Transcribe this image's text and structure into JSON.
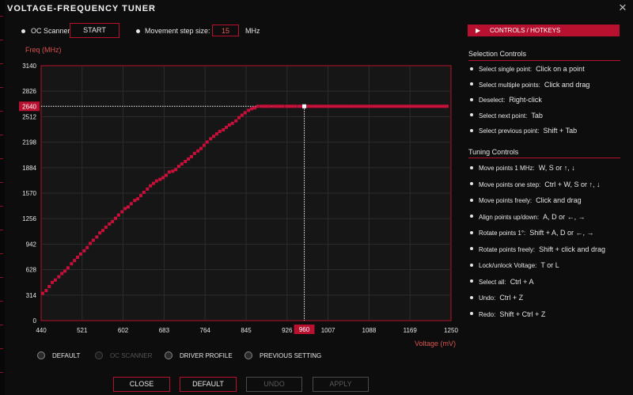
{
  "window": {
    "title": "VOLTAGE-FREQUENCY TUNER"
  },
  "toolbar": {
    "oc_scanner_label": "OC Scanner",
    "start_label": "START",
    "step_label": "Movement step size:",
    "step_value": "15",
    "step_unit": "MHz"
  },
  "chart_data": {
    "type": "scatter",
    "ylabel": "Freq (MHz)",
    "xlabel": "Voltage (mV)",
    "xlim": [
      440,
      1250
    ],
    "ylim": [
      0,
      3140
    ],
    "x_ticks": [
      "440",
      "521",
      "602",
      "683",
      "764",
      "845",
      "926",
      "1007",
      "1088",
      "1169",
      "1250"
    ],
    "y_ticks": [
      "0",
      "314",
      "628",
      "942",
      "1256",
      "1570",
      "1884",
      "2198",
      "2512",
      "2826",
      "3140"
    ],
    "selected_point": {
      "x": 960,
      "y": 2640,
      "x_label": "960",
      "y_label": "2640"
    },
    "grid": true,
    "series": [
      {
        "x": [
          443,
          450,
          456,
          462,
          468,
          475,
          481,
          487,
          493,
          500,
          506,
          512,
          518,
          525,
          531,
          537,
          543,
          550,
          556,
          562,
          568,
          575,
          581,
          587,
          593,
          600,
          606,
          612,
          618,
          625,
          631,
          637,
          643,
          650,
          656,
          662,
          668,
          675,
          681,
          687,
          693,
          700,
          706,
          712,
          718,
          725,
          731,
          737,
          743,
          750,
          756,
          762,
          768,
          775,
          781,
          787,
          793,
          800,
          806,
          812,
          818,
          825,
          831,
          837,
          843,
          850,
          856,
          862,
          868,
          875,
          881,
          887,
          893,
          900,
          906,
          912,
          918,
          925,
          931,
          937,
          943,
          950,
          956,
          960,
          966,
          972,
          978,
          984,
          990,
          996,
          1002,
          1008,
          1014,
          1020,
          1026,
          1032,
          1038,
          1044,
          1050,
          1056,
          1062,
          1068,
          1074,
          1080,
          1086,
          1092,
          1098,
          1104,
          1110,
          1116,
          1122,
          1128,
          1134,
          1140,
          1146,
          1152,
          1158,
          1164,
          1170,
          1176,
          1182,
          1188,
          1194,
          1200,
          1206,
          1212,
          1218,
          1224,
          1230,
          1236,
          1242
        ],
        "y": [
          335,
          370,
          420,
          470,
          500,
          540,
          580,
          610,
          650,
          700,
          740,
          780,
          820,
          860,
          900,
          950,
          990,
          1030,
          1080,
          1110,
          1150,
          1190,
          1220,
          1260,
          1300,
          1340,
          1380,
          1400,
          1440,
          1480,
          1500,
          1540,
          1580,
          1620,
          1660,
          1690,
          1720,
          1740,
          1760,
          1790,
          1830,
          1840,
          1860,
          1900,
          1930,
          1960,
          1990,
          2020,
          2060,
          2090,
          2120,
          2160,
          2200,
          2240,
          2270,
          2300,
          2330,
          2350,
          2380,
          2410,
          2430,
          2460,
          2500,
          2530,
          2560,
          2590,
          2610,
          2620,
          2640,
          2640,
          2640,
          2640,
          2640,
          2640,
          2640,
          2640,
          2640,
          2640,
          2640,
          2640,
          2640,
          2640,
          2640,
          2640,
          2640,
          2640,
          2640,
          2640,
          2640,
          2640,
          2640,
          2640,
          2640,
          2640,
          2640,
          2640,
          2640,
          2640,
          2640,
          2640,
          2640,
          2640,
          2640,
          2640,
          2640,
          2640,
          2640,
          2640,
          2640,
          2640,
          2640,
          2640,
          2640,
          2640,
          2640,
          2640,
          2640,
          2640,
          2640,
          2640,
          2640,
          2640,
          2640,
          2640,
          2640,
          2640,
          2640,
          2640,
          2640,
          2640,
          2640
        ]
      }
    ]
  },
  "profiles": [
    {
      "label": "DEFAULT",
      "disabled": false
    },
    {
      "label": "OC SCANNER",
      "disabled": true
    },
    {
      "label": "DRIVER PROFILE",
      "disabled": false
    },
    {
      "label": "PREVIOUS SETTING",
      "disabled": false
    }
  ],
  "footer": {
    "close_label": "CLOSE",
    "default_label": "DEFAULT",
    "undo_label": "UNDO",
    "apply_label": "APPLY"
  },
  "panel": {
    "header": "CONTROLS / HOTKEYS",
    "selection_title": "Selection Controls",
    "selection": [
      {
        "action": "Select single point:",
        "key": "Click on a point"
      },
      {
        "action": "Select multiple points:",
        "key": "Click and drag"
      },
      {
        "action": "Deselect:",
        "key": "Right-click"
      },
      {
        "action": "Select next point:",
        "key": "Tab"
      },
      {
        "action": "Select previous point:",
        "key": "Shift + Tab"
      }
    ],
    "tuning_title": "Tuning Controls",
    "tuning": [
      {
        "action": "Move points 1 MHz:",
        "key": "W, S or ↑, ↓"
      },
      {
        "action": "Move points one step:",
        "key": "Ctrl + W, S or ↑, ↓"
      },
      {
        "action": "Move points freely:",
        "key": "Click and drag"
      },
      {
        "action": "Align points up/down:",
        "key": "A, D or ←, →"
      },
      {
        "action": "Rotate points 1°:",
        "key": "Shift + A, D or ←, →"
      },
      {
        "action": "Rotate points freely:",
        "key": "Shift + click and drag"
      },
      {
        "action": "Lock/unlock Voltage:",
        "key": "T or L"
      },
      {
        "action": "Select all:",
        "key": "Ctrl + A"
      },
      {
        "action": "Undo:",
        "key": "Ctrl + Z"
      },
      {
        "action": "Redo:",
        "key": "Shift + Ctrl + Z"
      }
    ]
  }
}
